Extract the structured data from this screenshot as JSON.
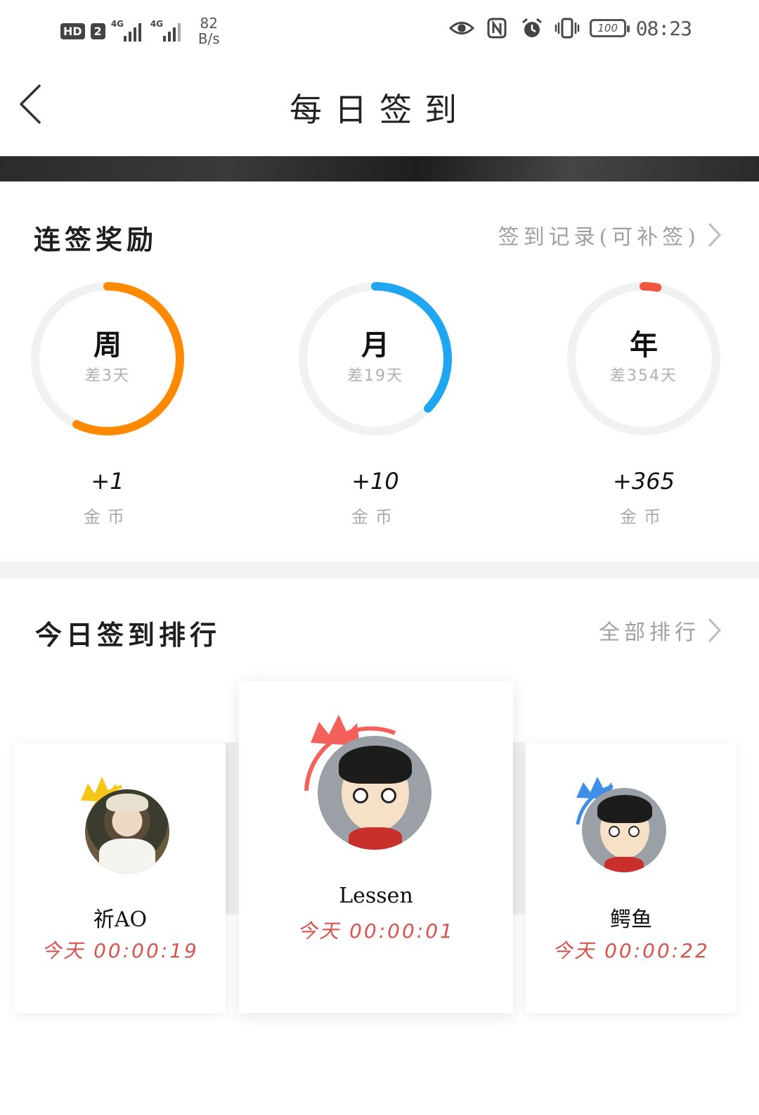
{
  "status_bar": {
    "hd": "HD",
    "sim": "2",
    "net1": "4G",
    "net2": "4G",
    "speed_value": "82",
    "speed_unit": "B/s",
    "battery": "100",
    "time": "08:23",
    "icons": [
      "eye-icon",
      "nfc-icon",
      "alarm-icon",
      "vibrate-icon",
      "battery-icon"
    ]
  },
  "header": {
    "title": "每日签到",
    "back_icon": "chevron-left-icon"
  },
  "streak": {
    "title": "连签奖励",
    "link": "签到记录(可补签)",
    "rings": [
      {
        "label": "周",
        "remaining": "差3天",
        "reward": "+1",
        "unit": "金币",
        "progress": 0.57,
        "color": "#ff8a00"
      },
      {
        "label": "月",
        "remaining": "差19天",
        "reward": "+10",
        "unit": "金币",
        "progress": 0.37,
        "color": "#1ea7f0"
      },
      {
        "label": "年",
        "remaining": "差354天",
        "reward": "+365",
        "unit": "金币",
        "progress": 0.03,
        "color": "#f2573e"
      }
    ]
  },
  "ranking": {
    "title": "今日签到排行",
    "link": "全部排行",
    "entries": [
      {
        "place": "2",
        "name": "祈AO",
        "time": "今天 00:00:19",
        "crown_color": "#f5c518"
      },
      {
        "place": "1",
        "name": "Lessen",
        "time": "今天 00:00:01",
        "crown_color": "#f4605a"
      },
      {
        "place": "3",
        "name": "鳄鱼",
        "time": "今天 00:00:22",
        "crown_color": "#3f8fe8"
      }
    ]
  }
}
